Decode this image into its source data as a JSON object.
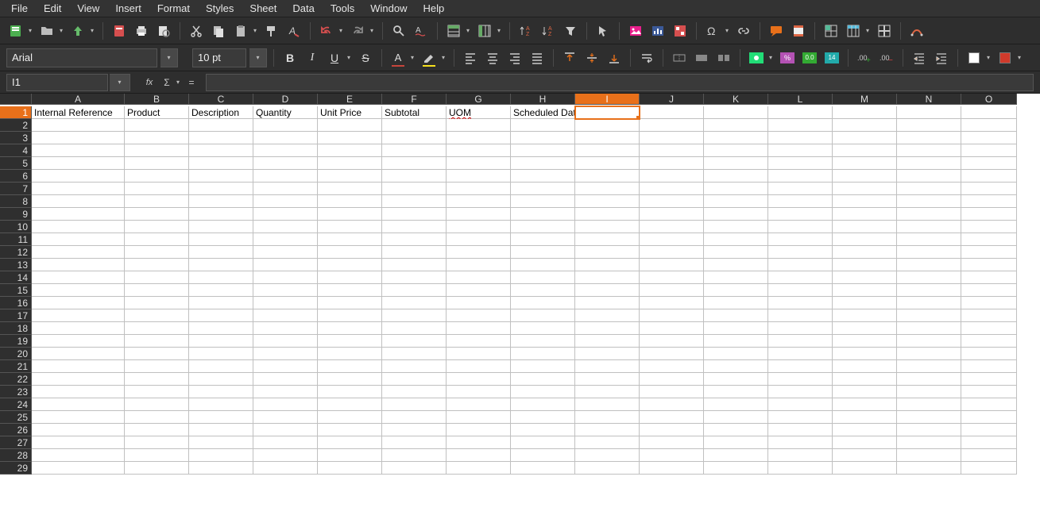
{
  "menu": {
    "items": [
      "File",
      "Edit",
      "View",
      "Insert",
      "Format",
      "Styles",
      "Sheet",
      "Data",
      "Tools",
      "Window",
      "Help"
    ]
  },
  "fontbar": {
    "font_name": "Arial",
    "font_size": "10 pt"
  },
  "namebox": {
    "value": "I1"
  },
  "formula": {
    "value": ""
  },
  "columns": [
    "A",
    "B",
    "C",
    "D",
    "E",
    "F",
    "G",
    "H",
    "I",
    "J",
    "K",
    "L",
    "M",
    "N",
    "O"
  ],
  "row_count": 29,
  "selected_col": "I",
  "selected_row": 1,
  "active_cell": "I1",
  "cells": {
    "A1": "Internal Reference",
    "B1": "Product",
    "C1": "Description",
    "D1": "Quantity",
    "E1": "Unit Price",
    "F1": "Subtotal",
    "G1": "UOM",
    "H1": "Scheduled Date"
  },
  "spellcheck_cells": [
    "G1"
  ],
  "colors": {
    "accent": "#e8701a",
    "font_color": "#c7453b",
    "highlight_color": "#f7e11d",
    "border_swatch": "#ffffff",
    "border_swatch2": "#d03a2b"
  },
  "icons": {
    "bold": "B",
    "italic": "I",
    "underline": "U",
    "strike": "S"
  }
}
